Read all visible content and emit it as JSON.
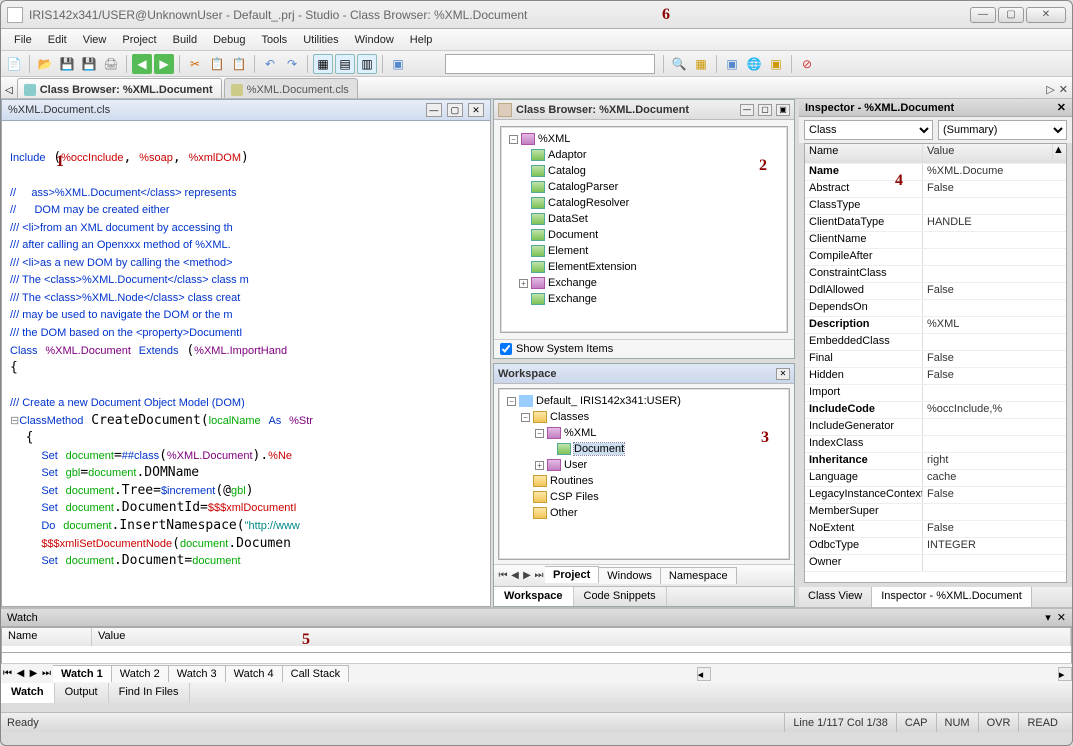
{
  "window": {
    "title": "IRIS142x341/USER@UnknownUser - Default_.prj - Studio - Class Browser:  %XML.Document",
    "annotation6": "6"
  },
  "menu": [
    "File",
    "Edit",
    "View",
    "Project",
    "Build",
    "Debug",
    "Tools",
    "Utilities",
    "Window",
    "Help"
  ],
  "doctabs": {
    "tab1": "Class Browser:  %XML.Document",
    "tab2": "%XML.Document.cls"
  },
  "editor": {
    "file": "%XML.Document.cls",
    "annotation1": "1",
    "code_lines": [
      {
        "t": "Include (",
        "k": "kw"
      },
      {
        "t": "%occInclude",
        "k": "sys"
      },
      {
        "t": ", ",
        "k": ""
      },
      {
        "t": "%soap",
        "k": "sys"
      },
      {
        "t": ", ",
        "k": ""
      },
      {
        "t": "%xmlDOM",
        "k": "sys"
      },
      {
        "t": ")",
        "k": "kw"
      }
    ]
  },
  "classbrowser": {
    "title": "Class Browser:  %XML.Document",
    "annotation2": "2",
    "root": "%XML",
    "items": [
      "Adaptor",
      "Catalog",
      "CatalogParser",
      "CatalogResolver",
      "DataSet",
      "Document",
      "Element",
      "ElementExtension"
    ],
    "subpkg": "Exchange",
    "subitem": "Exchange",
    "showSystemLabel": "Show System Items",
    "showSystemChecked": true
  },
  "workspace": {
    "title": "Workspace",
    "annotation3": "3",
    "root": "Default_  IRIS142x341:USER)",
    "classes": "Classes",
    "xml": "%XML",
    "doc": "Document",
    "user": "User",
    "routines": "Routines",
    "csp": "CSP Files",
    "other": "Other",
    "tabs": [
      "Project",
      "Windows",
      "Namespace"
    ],
    "bottomtabs": [
      "Workspace",
      "Code Snippets"
    ]
  },
  "inspector": {
    "title": "Inspector - %XML.Document",
    "combo1": "Class",
    "combo2": "(Summary)",
    "hdrName": "Name",
    "hdrValue": "Value",
    "annotation4": "4",
    "rows": [
      {
        "n": "Name",
        "v": "%XML.Docume",
        "b": true
      },
      {
        "n": "Abstract",
        "v": "False"
      },
      {
        "n": "ClassType",
        "v": ""
      },
      {
        "n": "ClientDataType",
        "v": "HANDLE"
      },
      {
        "n": "ClientName",
        "v": ""
      },
      {
        "n": "CompileAfter",
        "v": ""
      },
      {
        "n": "ConstraintClass",
        "v": ""
      },
      {
        "n": "DdlAllowed",
        "v": "False"
      },
      {
        "n": "DependsOn",
        "v": ""
      },
      {
        "n": "Description",
        "v": "<class>%XML",
        "b": true
      },
      {
        "n": "EmbeddedClass",
        "v": ""
      },
      {
        "n": "Final",
        "v": "False"
      },
      {
        "n": "Hidden",
        "v": "False"
      },
      {
        "n": "Import",
        "v": ""
      },
      {
        "n": "IncludeCode",
        "v": "%occInclude,%",
        "b": true
      },
      {
        "n": "IncludeGenerator",
        "v": ""
      },
      {
        "n": "IndexClass",
        "v": ""
      },
      {
        "n": "Inheritance",
        "v": "right",
        "b": true
      },
      {
        "n": "Language",
        "v": "cache"
      },
      {
        "n": "LegacyInstanceContext",
        "v": "False"
      },
      {
        "n": "MemberSuper",
        "v": ""
      },
      {
        "n": "NoExtent",
        "v": "False"
      },
      {
        "n": "OdbcType",
        "v": "INTEGER"
      },
      {
        "n": "Owner",
        "v": ""
      }
    ],
    "tabs": [
      "Class View",
      "Inspector - %XML.Document"
    ]
  },
  "watch": {
    "title": "Watch",
    "colName": "Name",
    "colValue": "Value",
    "annotation5": "5",
    "tabs": [
      "Watch 1",
      "Watch 2",
      "Watch 3",
      "Watch 4",
      "Call Stack"
    ],
    "outtabs": [
      "Watch",
      "Output",
      "Find In Files"
    ]
  },
  "status": {
    "ready": "Ready",
    "line": "Line 1/117 Col 1/38",
    "cap": "CAP",
    "num": "NUM",
    "ovr": "OVR",
    "read": "READ"
  }
}
